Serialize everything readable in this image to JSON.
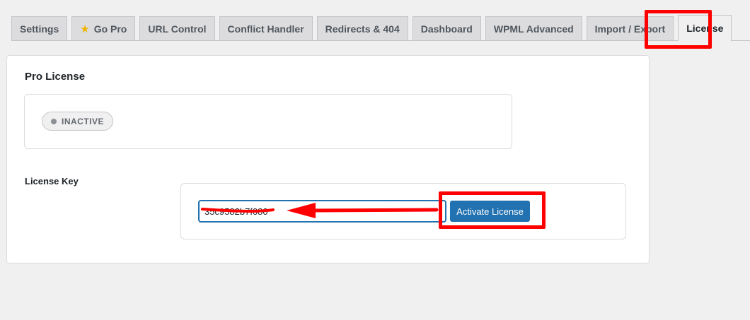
{
  "tabs": [
    {
      "label": "Settings",
      "icon": null,
      "active": false
    },
    {
      "label": "Go Pro",
      "icon": "star-icon",
      "active": false
    },
    {
      "label": "URL Control",
      "icon": null,
      "active": false
    },
    {
      "label": "Conflict Handler",
      "icon": null,
      "active": false
    },
    {
      "label": "Redirects & 404",
      "icon": null,
      "active": false
    },
    {
      "label": "Dashboard",
      "icon": null,
      "active": false
    },
    {
      "label": "WPML Advanced",
      "icon": null,
      "active": false
    },
    {
      "label": "Import / Export",
      "icon": null,
      "active": false
    },
    {
      "label": "License",
      "icon": null,
      "active": true
    }
  ],
  "pro_license": {
    "title": "Pro License",
    "status": "INACTIVE"
  },
  "license_key": {
    "label": "License Key",
    "value": "35c9582b7f080",
    "activate_label": "Activate License"
  },
  "colors": {
    "primary": "#2271b1",
    "annotation": "#ff0000",
    "star": "#f0b400",
    "background": "#f0f0f1"
  },
  "icons": {
    "go_pro": "star-icon"
  }
}
